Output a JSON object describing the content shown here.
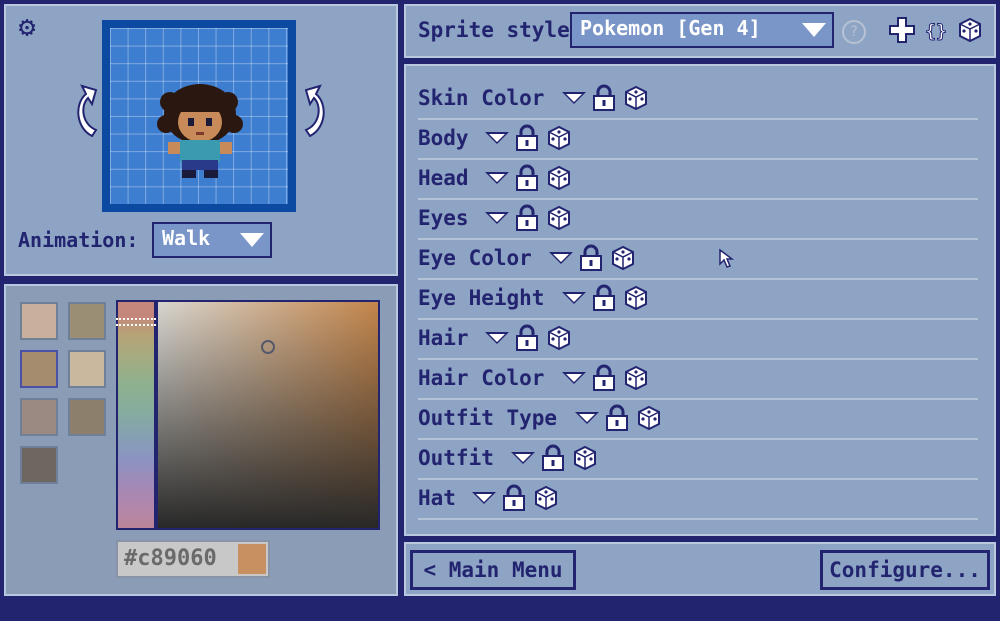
{
  "preview": {
    "animation_label": "Animation:",
    "animation_value": "Walk"
  },
  "palette": {
    "swatches": [
      "#c9b09c",
      "#9a8e74",
      "#a58c6e",
      "#c9b89e",
      "#9a8a82",
      "#8c806c",
      "#6e6660"
    ],
    "selected_index": 2,
    "hex_value": "#c89060",
    "hue_fraction": 0.07,
    "saturation_fraction": 0.5,
    "value_fraction": 0.8
  },
  "header": {
    "sprite_style_label": "Sprite style:",
    "sprite_style_value": "Pokemon [Gen 4]",
    "help": "?"
  },
  "attributes": [
    {
      "label": "Skin Color"
    },
    {
      "label": "Body"
    },
    {
      "label": "Head"
    },
    {
      "label": "Eyes"
    },
    {
      "label": "Eye Color"
    },
    {
      "label": "Eye Height"
    },
    {
      "label": "Hair"
    },
    {
      "label": "Hair Color"
    },
    {
      "label": "Outfit Type"
    },
    {
      "label": "Outfit"
    },
    {
      "label": "Hat"
    }
  ],
  "footer": {
    "main_menu": "< Main Menu",
    "configure": "Configure... >"
  },
  "colors": {
    "background": "#232470",
    "panel": "#8ea4c4",
    "accent": "#7a95c8",
    "text": "#232470"
  }
}
